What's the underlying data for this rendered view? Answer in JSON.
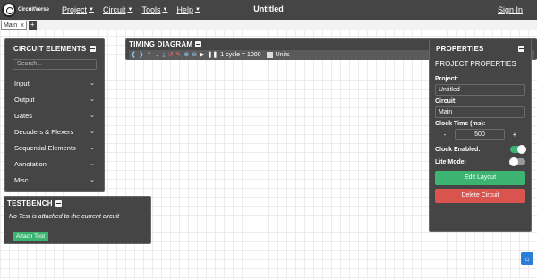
{
  "navbar": {
    "logo_text": "CircuitVerse",
    "menu": [
      {
        "label": "Project"
      },
      {
        "label": "Circuit"
      },
      {
        "label": "Tools"
      },
      {
        "label": "Help"
      }
    ],
    "title": "Untitled",
    "sign_in": "Sign In"
  },
  "tabs": {
    "items": [
      {
        "label": "Main",
        "close": "x"
      }
    ],
    "add": "+"
  },
  "circuit_elements": {
    "title": "CIRCUIT ELEMENTS",
    "search_placeholder": "Search...",
    "categories": [
      {
        "label": "Input"
      },
      {
        "label": "Output"
      },
      {
        "label": "Gates"
      },
      {
        "label": "Decoders & Plexers"
      },
      {
        "label": "Sequential Elements"
      },
      {
        "label": "Annotation"
      },
      {
        "label": "Misc"
      }
    ]
  },
  "testbench": {
    "title": "TESTBENCH",
    "message": "No Test is attached to the current circuit",
    "attach_label": "Attach Test"
  },
  "timing": {
    "title": "TIMING DIAGRAM",
    "cycle_text": "1 cycle = 1000",
    "units": "Units"
  },
  "properties": {
    "title": "PROPERTIES",
    "subtitle": "PROJECT PROPERTIES",
    "project_label": "Project:",
    "project_value": "Untitled",
    "circuit_label": "Circuit:",
    "circuit_value": "Main",
    "clock_time_label": "Clock Time (ms):",
    "clock_minus": "-",
    "clock_value": "500",
    "clock_plus": "+",
    "clock_enabled_label": "Clock Enabled:",
    "clock_enabled": true,
    "lite_mode_label": "Lite Mode:",
    "lite_mode": false,
    "edit_layout": "Edit Layout",
    "delete_circuit": "Delete Circuit"
  },
  "colors": {
    "panel_bg": "#454545",
    "accent_green": "#3cb371",
    "danger_red": "#d9534f",
    "report_blue": "#2b7dd6"
  }
}
